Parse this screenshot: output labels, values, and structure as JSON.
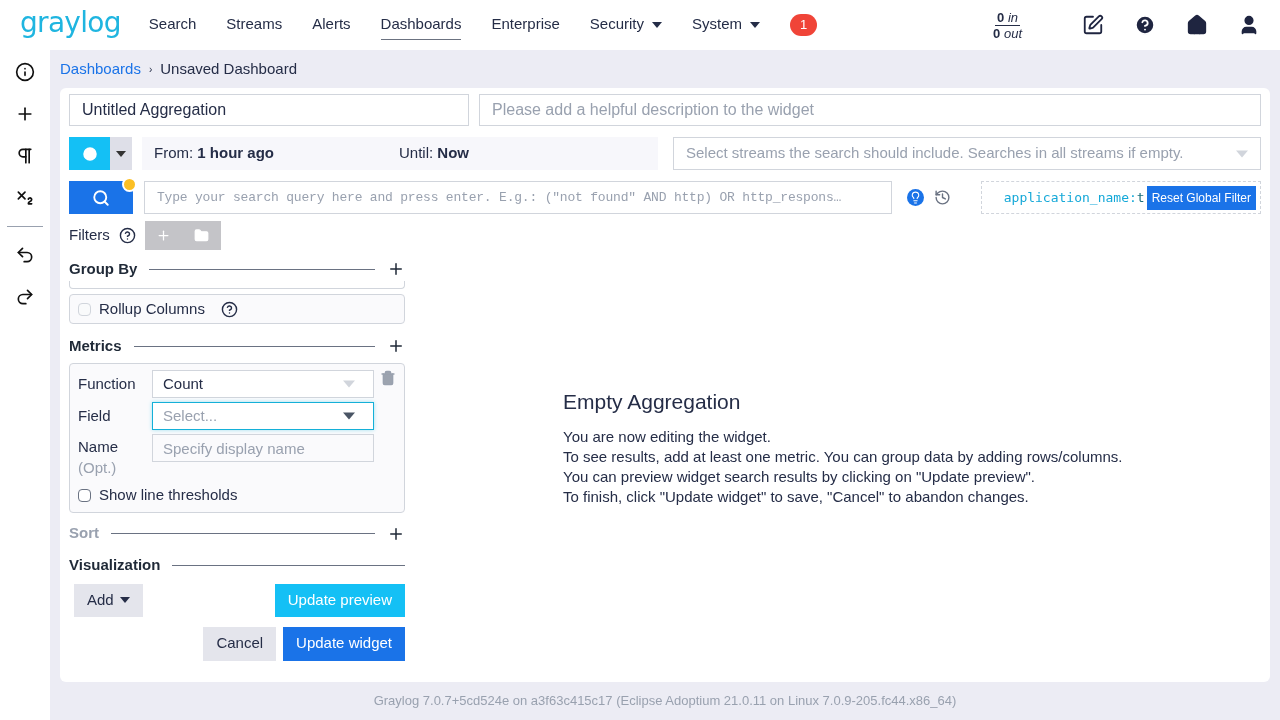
{
  "logo": "graylog",
  "nav": [
    {
      "label": "Search",
      "selected": false,
      "dropdown": false
    },
    {
      "label": "Streams",
      "selected": false,
      "dropdown": false
    },
    {
      "label": "Alerts",
      "selected": false,
      "dropdown": false
    },
    {
      "label": "Dashboards",
      "selected": true,
      "dropdown": false
    },
    {
      "label": "Enterprise",
      "selected": false,
      "dropdown": false
    },
    {
      "label": "Security",
      "selected": false,
      "dropdown": true
    },
    {
      "label": "System",
      "selected": false,
      "dropdown": true
    }
  ],
  "notification_count": "1",
  "throughput": {
    "in_value": "0",
    "in_label": "in",
    "out_value": "0",
    "out_label": "out"
  },
  "breadcrumb": {
    "link": "Dashboards",
    "separator": "›",
    "current": "Unsaved Dashboard"
  },
  "widget": {
    "title": "Untitled Aggregation",
    "description_placeholder": "Please add a helpful description to the widget"
  },
  "time_range": {
    "from_label": "From:",
    "from_value": "1 hour ago",
    "until_label": "Until:",
    "until_value": "Now"
  },
  "streams_placeholder": "Select streams the search should include. Searches in all streams if empty.",
  "query_placeholder": "Type your search query here and press enter. E.g.: (\"not found\" AND http) OR http_respons…",
  "global_filter": {
    "field": "application_name:",
    "value": "t",
    "reset_label": "Reset Global Filter"
  },
  "filters_label": "Filters",
  "sections": [
    {
      "title": "Group By",
      "disabled": false,
      "addable": true
    },
    {
      "title": "Metrics",
      "disabled": false,
      "addable": true
    },
    {
      "title": "Sort",
      "disabled": true,
      "addable": true
    },
    {
      "title": "Visualization",
      "disabled": false,
      "addable": false
    }
  ],
  "rollup": {
    "label": "Rollup Columns",
    "checked": false,
    "disabled": true
  },
  "metric": {
    "function_label": "Function",
    "function_value": "Count",
    "field_label": "Field",
    "field_placeholder": "Select...",
    "field_focused": true,
    "name_label": "Name",
    "name_hint": "(Opt.)",
    "name_placeholder": "Specify display name",
    "thresholds_label": "Show line thresholds",
    "thresholds_checked": false
  },
  "add_button": "Add",
  "update_preview": "Update preview",
  "cancel": "Cancel",
  "update_widget": "Update widget",
  "empty": {
    "title": "Empty Aggregation",
    "lines": [
      "You are now editing the widget.",
      "To see results, add at least one metric. You can group data by adding rows/columns.",
      "You can preview widget search results by clicking on \"Update preview\".",
      "To finish, click \"Update widget\" to save, \"Cancel\" to abandon changes."
    ]
  },
  "footer": "Graylog 7.0.7+5cd524e on a3f63c415c17 (Eclipse Adoptium 21.0.11 on Linux 7.0.9-205.fc44.x86_64)"
}
